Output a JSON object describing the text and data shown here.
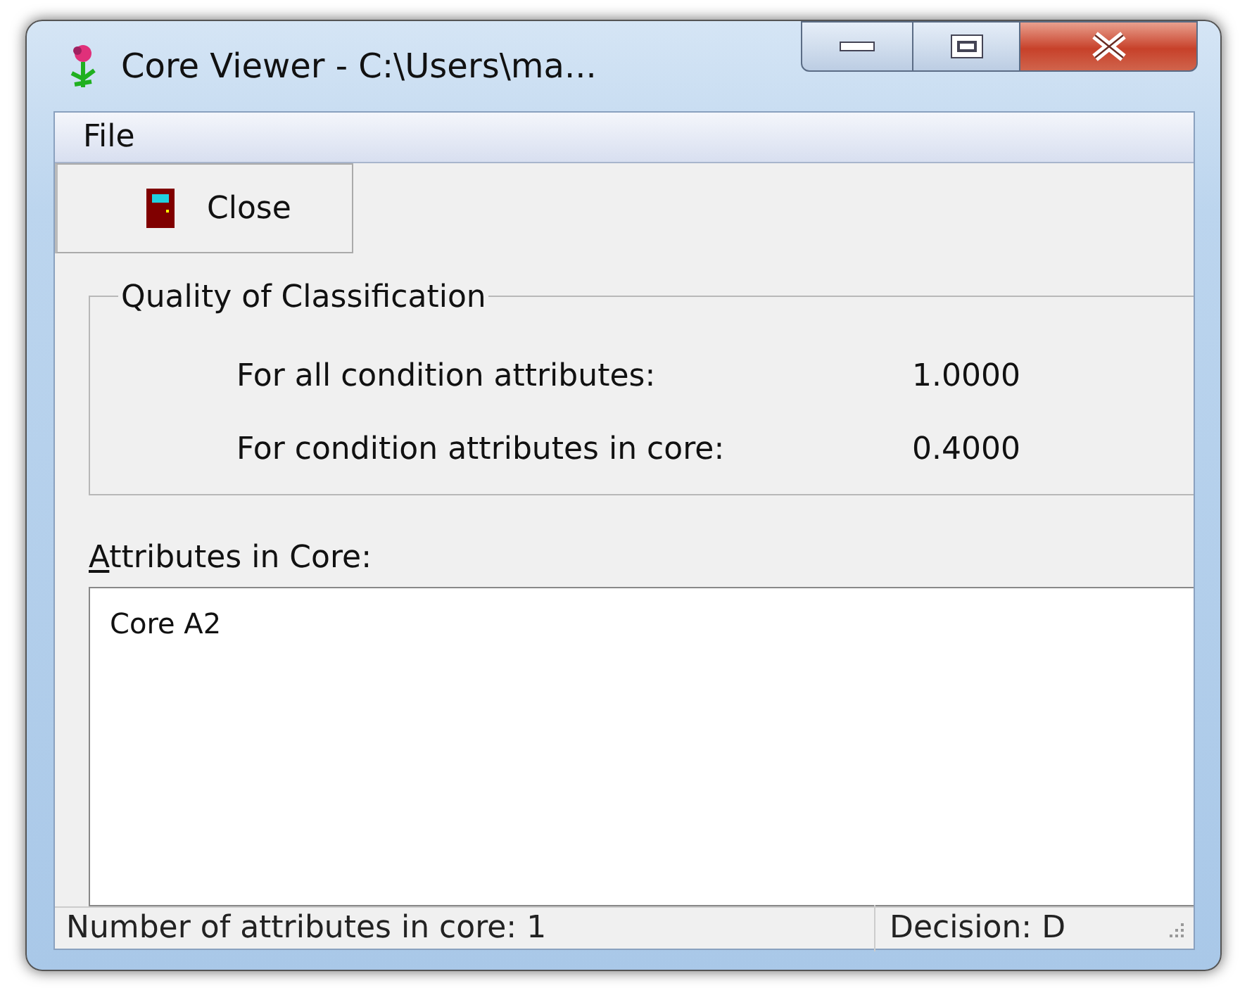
{
  "window": {
    "title": "Core Viewer - C:\\Users\\ma..."
  },
  "menu": [
    "File"
  ],
  "toolbar": [
    {
      "label": "Close"
    }
  ],
  "quality_group": {
    "title": "Quality of Classification",
    "rows": [
      {
        "label": "For all condition attributes:",
        "value": "1.0000"
      },
      {
        "label": "For condition attributes in core:",
        "value": "0.4000"
      }
    ]
  },
  "core_list": {
    "label": "Attributes in Core:",
    "items": [
      "Core A2"
    ]
  },
  "status_bar": [
    "Number of attributes in core: 1",
    "Decision: D"
  ]
}
